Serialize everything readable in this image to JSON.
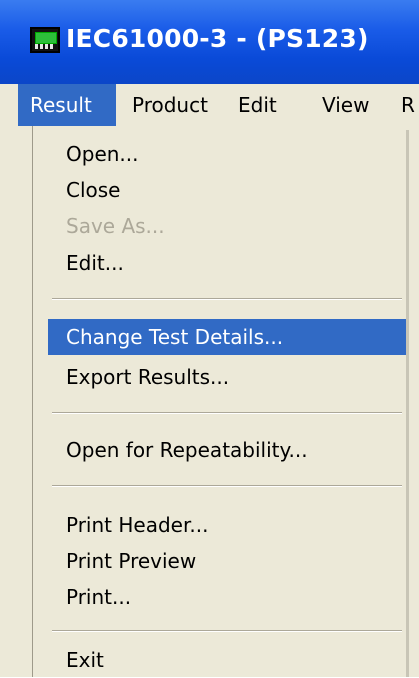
{
  "window": {
    "title": "IEC61000-3 - (PS123)",
    "icon": "app-monitor-icon"
  },
  "menubar": {
    "items": [
      {
        "label": "Result",
        "active": true
      },
      {
        "label": "Product"
      },
      {
        "label": "Edit"
      },
      {
        "label": "View"
      },
      {
        "label": "R"
      }
    ]
  },
  "result_menu": {
    "items": [
      {
        "label": "Open..."
      },
      {
        "label": "Close"
      },
      {
        "label": "Save As...",
        "disabled": true
      },
      {
        "label": "Edit..."
      },
      {
        "label": "Change Test Details...",
        "selected": true
      },
      {
        "label": "Export Results..."
      },
      {
        "label": "Open for Repeatability..."
      },
      {
        "label": "Print Header..."
      },
      {
        "label": "Print Preview"
      },
      {
        "label": "Print..."
      },
      {
        "label": "Exit"
      }
    ]
  },
  "colors": {
    "titlebar": "#0a4ad8",
    "highlight": "#316ac5",
    "menu_bg": "#ece9d8",
    "disabled_text": "#aca899"
  }
}
